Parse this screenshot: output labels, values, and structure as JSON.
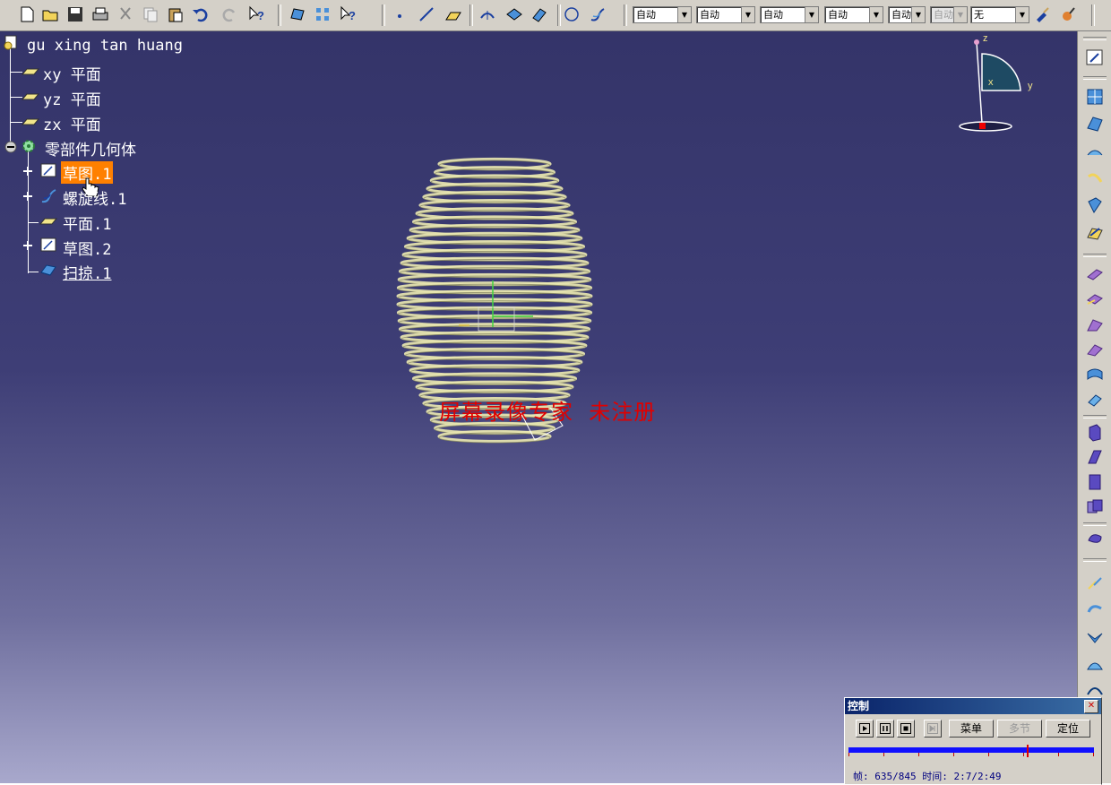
{
  "toolbar": {
    "dropdowns": [
      {
        "value": "自动",
        "disabled": false
      },
      {
        "value": "自动",
        "disabled": false
      },
      {
        "value": "自动",
        "disabled": false
      },
      {
        "value": "自动",
        "disabled": false
      },
      {
        "value": "自动",
        "disabled": false
      },
      {
        "value": "自动",
        "disabled": true
      },
      {
        "value": "无",
        "disabled": false
      }
    ]
  },
  "tree": {
    "root": "gu xing tan huang",
    "plane_xy": "xy 平面",
    "plane_yz": "yz 平面",
    "plane_zx": "zx 平面",
    "body": "零部件几何体",
    "sketch1": "草图.1",
    "helix1": "螺旋线.1",
    "plane1": "平面.1",
    "sketch2": "草图.2",
    "sweep1": "扫掠.1"
  },
  "compass": {
    "z": "z",
    "x": "x",
    "y": "y"
  },
  "watermark": "屏幕录像专家  未注册",
  "control": {
    "title": "控制",
    "menu_label": "菜单",
    "multi_label": "多节",
    "locate_label": "定位",
    "status": "帧: 635/845 时间: 2:7/2:49",
    "progress": 0.75
  },
  "colors": {
    "background_top": "#343469",
    "background_bottom": "#a8a8cc",
    "spring": "#e8e6b0",
    "selection": "#ff8000",
    "watermark": "#e00000"
  }
}
